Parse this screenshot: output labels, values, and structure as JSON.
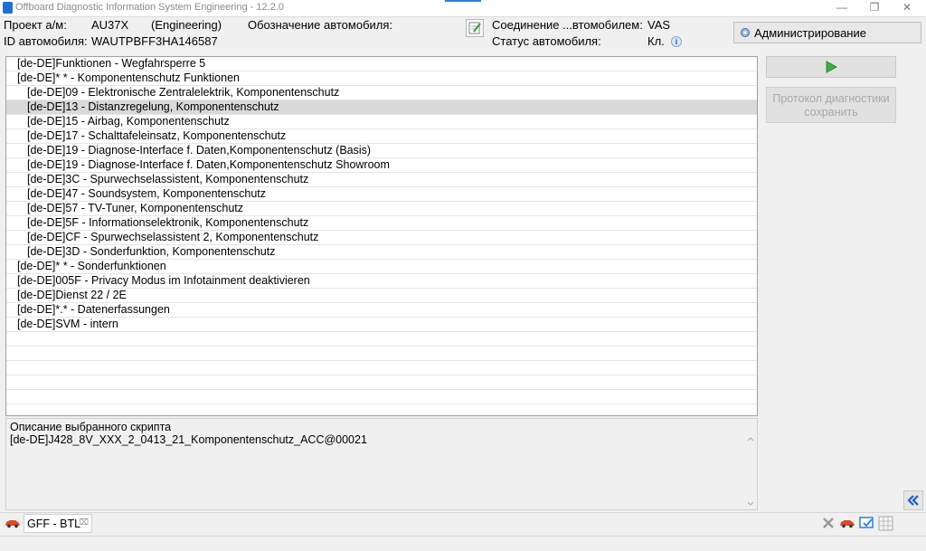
{
  "window": {
    "title": "Offboard Diagnostic Information System Engineering - 12.2.0",
    "minimize": "—",
    "restore": "❐",
    "close": "✕"
  },
  "header": {
    "project_label": "Проект а/м:",
    "project_value": "AU37X",
    "project_mode": "(Engineering)",
    "designation_label": "Обозначение автомобиля:",
    "vehicle_id_label": "ID автомобиля:",
    "vehicle_id_value": "WAUTPBFF3HA146587",
    "connection_label": "Соединение ...втомобилем:",
    "connection_value": "VAS",
    "status_label": "Статус автомобиля:",
    "status_value": "Кл.",
    "admin_button": "Администрирование"
  },
  "scripts": [
    {
      "text": "[de-DE]Funktionen - Wegfahrsperre 5",
      "indent": 0
    },
    {
      "text": "[de-DE]* * - Komponentenschutz Funktionen",
      "indent": 0
    },
    {
      "text": "[de-DE]09 - Elektronische Zentralelektrik, Komponentenschutz",
      "indent": 1
    },
    {
      "text": "[de-DE]13 - Distanzregelung, Komponentenschutz",
      "indent": 1,
      "selected": true
    },
    {
      "text": "[de-DE]15 - Airbag, Komponentenschutz",
      "indent": 1
    },
    {
      "text": "[de-DE]17 - Schalttafeleinsatz, Komponentenschutz",
      "indent": 1
    },
    {
      "text": "[de-DE]19 - Diagnose-Interface f. Daten,Komponentenschutz (Basis)",
      "indent": 1
    },
    {
      "text": "[de-DE]19 - Diagnose-Interface f. Daten,Komponentenschutz Showroom",
      "indent": 1
    },
    {
      "text": "[de-DE]3C - Spurwechselassistent, Komponentenschutz",
      "indent": 1
    },
    {
      "text": "[de-DE]47 - Soundsystem, Komponentenschutz",
      "indent": 1
    },
    {
      "text": "[de-DE]57 - TV-Tuner, Komponentenschutz",
      "indent": 1
    },
    {
      "text": "[de-DE]5F - Informationselektronik, Komponentenschutz",
      "indent": 1
    },
    {
      "text": "[de-DE]CF - Spurwechselassistent 2, Komponentenschutz",
      "indent": 1
    },
    {
      "text": "[de-DE]3D - Sonderfunktion, Komponentenschutz",
      "indent": 1
    },
    {
      "text": "[de-DE]* * - Sonderfunktionen",
      "indent": 0
    },
    {
      "text": "[de-DE]005F - Privacy Modus im Infotainment deaktivieren",
      "indent": 0
    },
    {
      "text": "[de-DE]Dienst 22 / 2E",
      "indent": 0
    },
    {
      "text": "[de-DE]*.* - Datenerfassungen",
      "indent": 0
    },
    {
      "text": "[de-DE]SVM - intern",
      "indent": 0
    }
  ],
  "right_panel": {
    "protocol_button": "Протокол диагностики сохранить"
  },
  "description": {
    "title": "Описание выбранного скрипта",
    "value": "[de-DE]J428_8V_XXX_2_0413_21_Komponentenschutz_ACC@00021"
  },
  "tabs": [
    {
      "label": "GFF - BTL",
      "close": "⌧"
    }
  ],
  "colors": {
    "accent": "#2b7de1",
    "selection": "#d9d9d9",
    "run_green": "#3cb043",
    "car_red": "#d84a2b"
  }
}
